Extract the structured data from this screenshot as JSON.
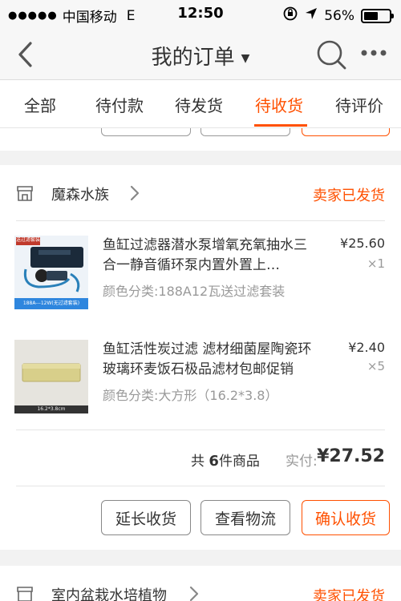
{
  "status_bar": {
    "signal_dots": "●●●●●",
    "carrier": "中国移动",
    "network": "E",
    "time": "12:50",
    "battery_text": "56%",
    "battery_level": 0.56
  },
  "nav": {
    "title": "我的订单",
    "caret": "▼",
    "back_icon": "chevron-left-icon",
    "search_icon": "search-icon",
    "more_icon": "more-dots-icon"
  },
  "tabs": [
    {
      "label": "全部",
      "active": false
    },
    {
      "label": "待付款",
      "active": false
    },
    {
      "label": "待发货",
      "active": false
    },
    {
      "label": "待收货",
      "active": true
    },
    {
      "label": "待评价",
      "active": false
    }
  ],
  "order": {
    "shop_name": "魔森水族",
    "status": "卖家已发货",
    "items": [
      {
        "name": "鱼缸过滤器潜水泵增氧充氧抽水三合一静音循环泵内置外置上…",
        "sku": "颜色分类:188A12瓦送过滤套装",
        "price": "¥25.60",
        "qty": "×1",
        "thumb_badge": "送过滤套装",
        "thumb_caption": "188A---12W(无过滤套装)"
      },
      {
        "name": "鱼缸活性炭过滤 滤材细菌屋陶瓷环玻璃环麦饭石极品滤材包邮促销",
        "sku": "颜色分类:大方形（16.2*3.8）",
        "price": "¥2.40",
        "qty": "×5",
        "thumb_caption": "16.2*3.8cm"
      }
    ],
    "total_prefix": "共",
    "total_count": "6",
    "total_suffix": "件商品",
    "paid_label": "实付:",
    "paid_amount": "¥27.52",
    "actions": [
      "延长收货",
      "查看物流",
      "确认收货"
    ]
  },
  "next_order": {
    "shop_name": "室内盆栽水培植物",
    "status": "卖家已发货"
  },
  "colors": {
    "accent": "#ff5000",
    "text": "#333333",
    "muted": "#999999"
  }
}
